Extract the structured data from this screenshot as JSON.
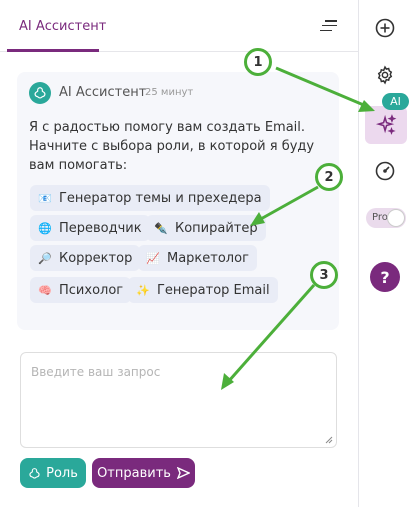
{
  "header": {
    "tab_label": "AI Ассистент"
  },
  "bot": {
    "name": "AI Ассистент",
    "time": "25 минут",
    "message": "Я с радостью помогу вам создать Email. Начните с выбора роли, в которой я буду вам помогать:"
  },
  "roles": [
    {
      "emoji": "📧",
      "label": "Генератор темы и прехедера"
    },
    {
      "emoji": "🌐",
      "label": "Переводчик"
    },
    {
      "emoji": "✒️",
      "label": "Копирайтер"
    },
    {
      "emoji": "🔎",
      "label": "Корректор"
    },
    {
      "emoji": "📈",
      "label": "Маркетолог"
    },
    {
      "emoji": "🧠",
      "label": "Психолог"
    },
    {
      "emoji": "✨",
      "label": "Генератор Email"
    }
  ],
  "input": {
    "placeholder": "Введите ваш запрос"
  },
  "buttons": {
    "role_label": "Роль",
    "send_label": "Отправить"
  },
  "sidebar": {
    "ai_badge": "AI",
    "pro_label": "Pro",
    "help_label": "?"
  },
  "annotations": [
    "1",
    "2",
    "3"
  ],
  "colors": {
    "accent": "#7a2a7d",
    "teal": "#2aa89a",
    "arrow": "#4caf3a"
  }
}
